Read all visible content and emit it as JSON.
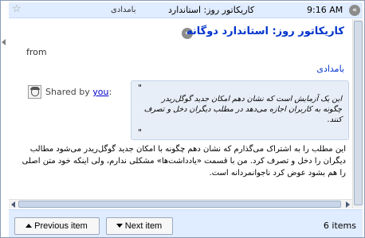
{
  "header": {
    "source": "بامدادی",
    "title": "کاریکاتور روز: استاندارد",
    "time": "9:16 AM"
  },
  "item": {
    "title": "کاریکاتور روز: استاندارد دوگانه",
    "from_label": "from",
    "author": "بامدادی",
    "shared_prefix": "Shared by",
    "shared_user": "you",
    "shared_suffix": ":",
    "quote_open": "\"",
    "quote_text": "این یک آزمایش است که نشان دهم امکان جدید گوگل‌ریدر چگونه به کاربران اجازه می‌دهد در مطلب دیگران دخل و تصرف کنند.",
    "quote_close": "\"",
    "body": "این مطلب را به اشتراک می‌گذارم که نشان دهم چگونه با امکان جدید گوگل‌ریدر می‌شود مطالب دیگران را دخل و تصرف کرد. من با قسمت «یادداشت‌ها» مشکلی ندارم، ولی اینکه خود متن اصلی را هم بشود عوض کرد ناجوانمردانه است."
  },
  "footer": {
    "prev_label": "Previous item",
    "next_label": "Next item",
    "count": "6 items"
  },
  "icons": {
    "star": "star-icon",
    "arrow": "circle-arrow-icon",
    "avatar": "user-avatar-icon"
  },
  "colors": {
    "header_bg": "#e0ecff",
    "link": "#0033cc",
    "quote_bg": "#e8eef7"
  }
}
